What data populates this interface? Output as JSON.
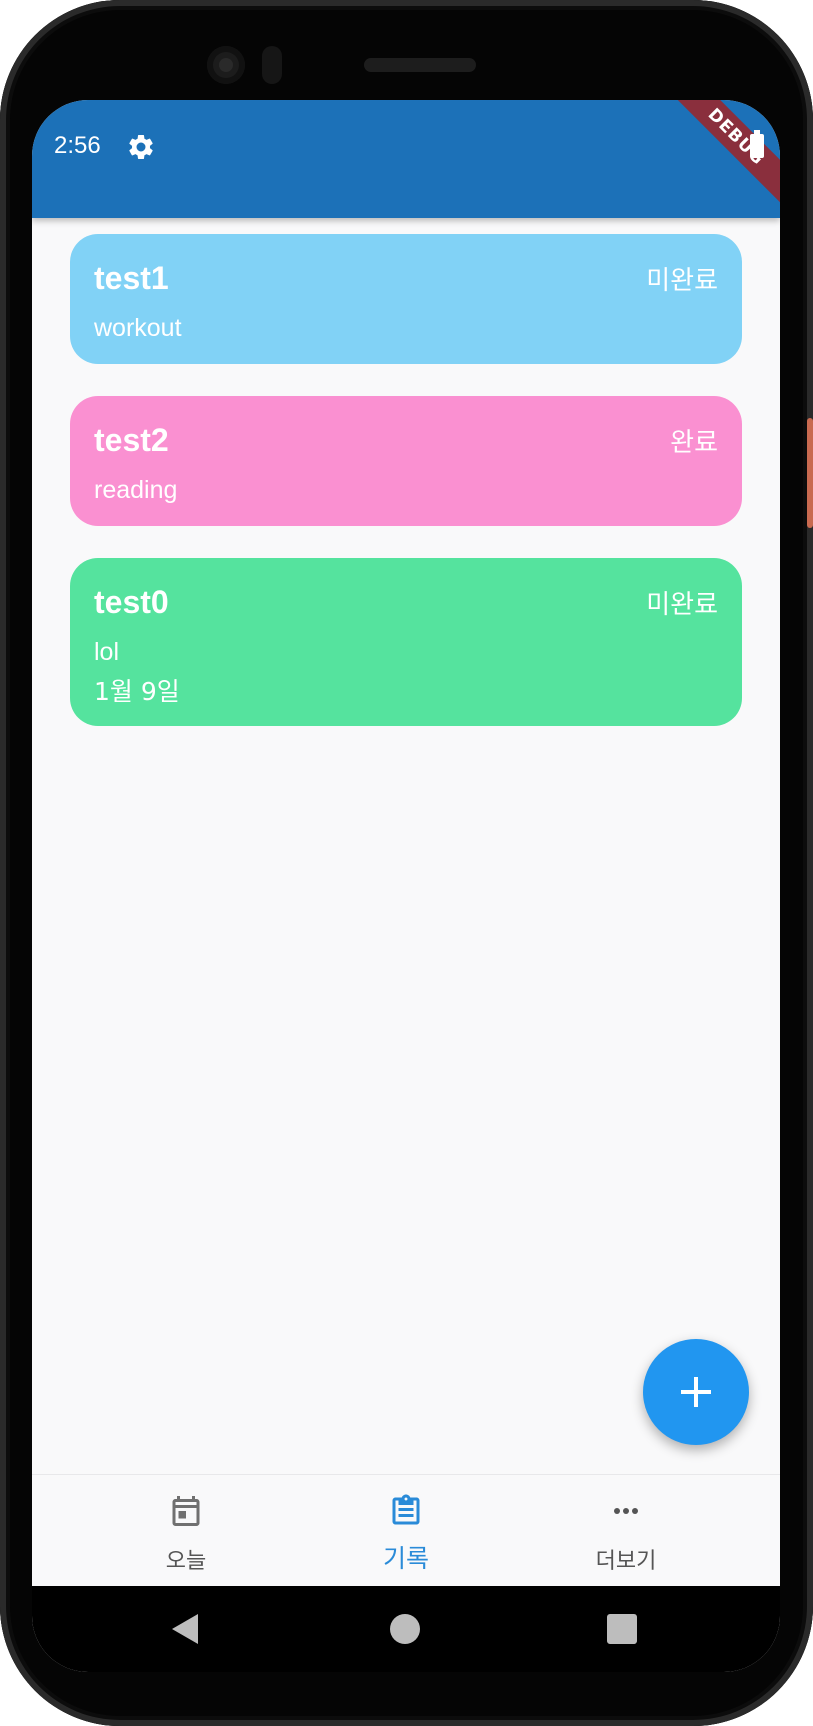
{
  "status_bar": {
    "time": "2:56",
    "debug_banner": "DEBUG"
  },
  "records": [
    {
      "title": "test1",
      "status": "미완료",
      "description": "workout",
      "date": "",
      "color": "#81d2f6"
    },
    {
      "title": "test2",
      "status": "완료",
      "description": "reading",
      "date": "",
      "color": "#fa90d1"
    },
    {
      "title": "test0",
      "status": "미완료",
      "description": "lol",
      "date": "1월 9일",
      "color": "#55e39e"
    }
  ],
  "fab": {
    "icon": "plus-icon"
  },
  "bottom_nav": {
    "items": [
      {
        "label": "오늘",
        "icon": "calendar-icon",
        "active": false
      },
      {
        "label": "기록",
        "icon": "clipboard-icon",
        "active": true
      },
      {
        "label": "더보기",
        "icon": "more-horizontal-icon",
        "active": false
      }
    ]
  },
  "colors": {
    "appbar": "#1c71b8",
    "accent": "#2196f0",
    "active_nav": "#2a8bd8"
  }
}
